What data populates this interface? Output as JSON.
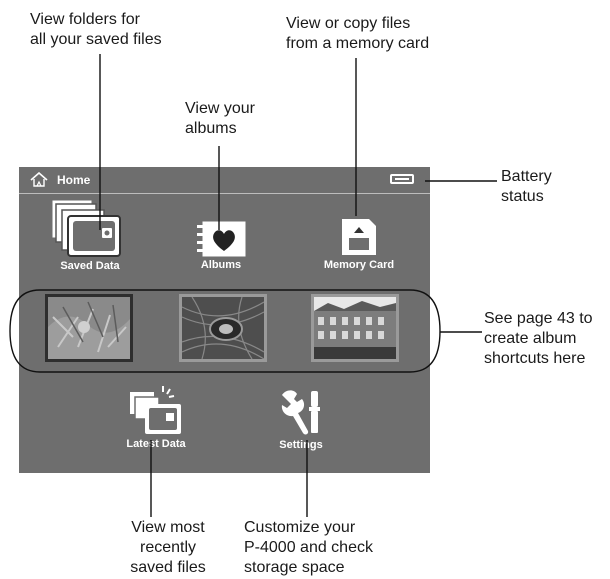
{
  "callouts": {
    "saved_folders": "View folders for\nall your saved files",
    "memory_card": "View or copy files\nfrom a memory card",
    "albums": "View your\nalbums",
    "battery": "Battery\nstatus",
    "shortcuts": "See page 43 to\ncreate album\nshortcuts here",
    "latest": "View most\nrecently\nsaved files",
    "settings": "Customize your\nP-4000 and check\nstorage space"
  },
  "screen": {
    "title": "Home",
    "home_icon": "home-icon",
    "battery_icon": "battery-icon",
    "buttons": {
      "saved_data": "Saved Data",
      "albums": "Albums",
      "memory_card": "Memory Card",
      "latest_data": "Latest Data",
      "settings": "Settings"
    },
    "thumbnails": [
      {
        "name": "album-shortcut-1",
        "subject": "plant photo"
      },
      {
        "name": "album-shortcut-2",
        "subject": "peacock feather photo"
      },
      {
        "name": "album-shortcut-3",
        "subject": "building facade photo"
      }
    ]
  },
  "colors": {
    "screen_background": "#6e6e6e",
    "selected_border": "#2e2e2e",
    "thumbnail_border": "#9a9a9a"
  }
}
